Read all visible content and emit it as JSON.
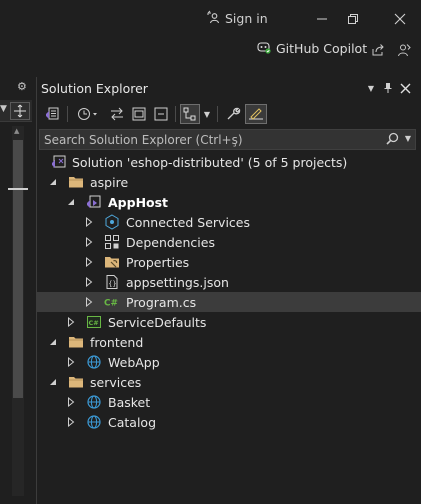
{
  "titlebar": {
    "signin_label": "Sign in"
  },
  "toolbar2": {
    "copilot_label": "GitHub Copilot"
  },
  "solution_explorer": {
    "title": "Solution Explorer",
    "search_placeholder": "Search Solution Explorer (Ctrl+ş)",
    "tree": [
      {
        "label": "Solution 'eshop-distributed' (5 of 5 projects)",
        "level": 0,
        "expander": "none",
        "icon": "solution-icon",
        "bold": false
      },
      {
        "label": "aspire",
        "level": 1,
        "expander": "expanded",
        "icon": "folder-icon",
        "bold": false
      },
      {
        "label": "AppHost",
        "level": 2,
        "expander": "expanded",
        "icon": "apphost-project-icon",
        "bold": true
      },
      {
        "label": "Connected Services",
        "level": 3,
        "expander": "collapsed",
        "icon": "connected-services-icon",
        "bold": false
      },
      {
        "label": "Dependencies",
        "level": 3,
        "expander": "collapsed",
        "icon": "dependencies-icon",
        "bold": false
      },
      {
        "label": "Properties",
        "level": 3,
        "expander": "collapsed",
        "icon": "properties-icon",
        "bold": false
      },
      {
        "label": "appsettings.json",
        "level": 3,
        "expander": "collapsed",
        "icon": "json-file-icon",
        "bold": false
      },
      {
        "label": "Program.cs",
        "level": 3,
        "expander": "collapsed",
        "icon": "csharp-file-icon",
        "bold": false,
        "selected": true
      },
      {
        "label": "ServiceDefaults",
        "level": 2,
        "expander": "collapsed",
        "icon": "csharp-project-icon",
        "bold": false
      },
      {
        "label": "frontend",
        "level": 1,
        "expander": "expanded",
        "icon": "folder-icon",
        "bold": false
      },
      {
        "label": "WebApp",
        "level": 2,
        "expander": "collapsed",
        "icon": "web-project-icon",
        "bold": false
      },
      {
        "label": "services",
        "level": 1,
        "expander": "expanded",
        "icon": "folder-icon",
        "bold": false
      },
      {
        "label": "Basket",
        "level": 2,
        "expander": "collapsed",
        "icon": "web-project-icon",
        "bold": false
      },
      {
        "label": "Catalog",
        "level": 2,
        "expander": "collapsed",
        "icon": "web-project-icon",
        "bold": false
      }
    ]
  },
  "colors": {
    "background": "#1f1f1f",
    "selection": "#3c3c3c",
    "folder": "#dcb67a",
    "csharp": "#68b744",
    "web": "#3c9ad6",
    "apphost": "#8a6fd1"
  }
}
